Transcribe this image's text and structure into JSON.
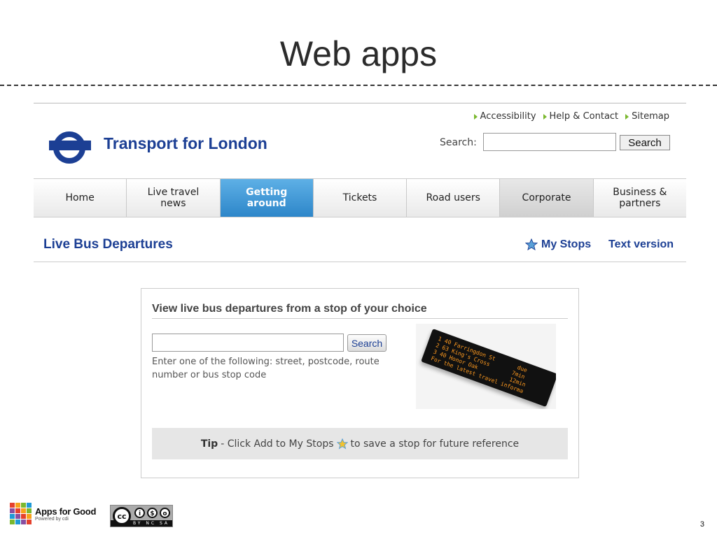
{
  "slide": {
    "title": "Web apps",
    "page_number": "3"
  },
  "site": {
    "brand": "Transport for London",
    "utility_links": [
      "Accessibility",
      "Help & Contact",
      "Sitemap"
    ],
    "search": {
      "label": "Search:",
      "value": "",
      "button": "Search"
    },
    "nav": [
      {
        "label": "Home",
        "state": "normal"
      },
      {
        "label": "Live travel\nnews",
        "state": "normal"
      },
      {
        "label": "Getting\naround",
        "state": "active"
      },
      {
        "label": "Tickets",
        "state": "normal"
      },
      {
        "label": "Road users",
        "state": "normal"
      },
      {
        "label": "Corporate",
        "state": "grey"
      },
      {
        "label": "Business &\npartners",
        "state": "normal"
      }
    ],
    "page_heading": "Live Bus Departures",
    "my_stops": "My Stops",
    "text_version": "Text version",
    "panel": {
      "title": "View live bus departures from a stop of your choice",
      "input_value": "",
      "search_button": "Search",
      "help": "Enter one of the following: street, postcode, route number or bus stop code",
      "tip_label": "Tip",
      "tip_before": " - Click Add to My Stops",
      "tip_after": "to save a stop for future reference",
      "sign_lines": "1 40 Farringdon St       due\n2 63 King's Cross       7min\n3 40 Honor Oak          12min\nFor the latest travel informa"
    },
    "colors": {
      "brand_blue": "#1c3f94",
      "nav_active": "#2d86c9",
      "link_arrow": "#7ab82f"
    }
  },
  "footer": {
    "apps_for_good": "Apps for Good",
    "powered_by": "Powered by cdi",
    "cc_labels": "BY NC SA"
  }
}
